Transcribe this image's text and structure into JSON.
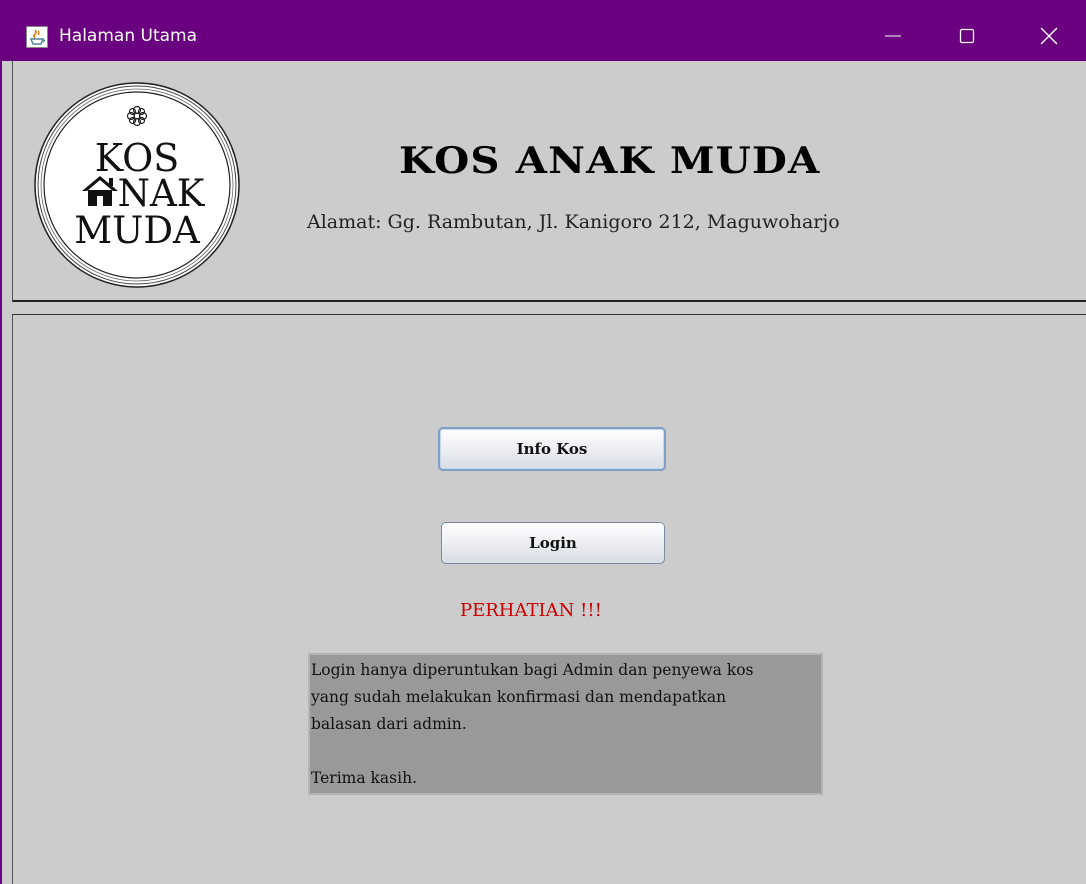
{
  "window": {
    "title": "Halaman Utama",
    "icon": "java-cup-icon",
    "controls": {
      "minimize": "minimize-icon",
      "maximize": "maximize-icon",
      "close": "close-icon"
    }
  },
  "header": {
    "logo": {
      "line1": "KOS",
      "line2": "NAK",
      "line3": "MUDA"
    },
    "title": "KOS ANAK MUDA",
    "address": "Alamat: Gg. Rambutan, Jl. Kanigoro 212, Maguwoharjo"
  },
  "main": {
    "info_button_label": "Info Kos",
    "login_button_label": "Login",
    "notice_title": "PERHATIAN !!!",
    "notice_text": "Login hanya diperuntukan bagi Admin dan penyewa kos\nyang sudah melakukan konfirmasi dan mendapatkan\nbalasan dari admin.\n\nTerima kasih."
  },
  "colors": {
    "titlebar": "#6a0080",
    "background": "#cccccc",
    "notice_title": "#cc0000",
    "notice_box": "#999999"
  }
}
